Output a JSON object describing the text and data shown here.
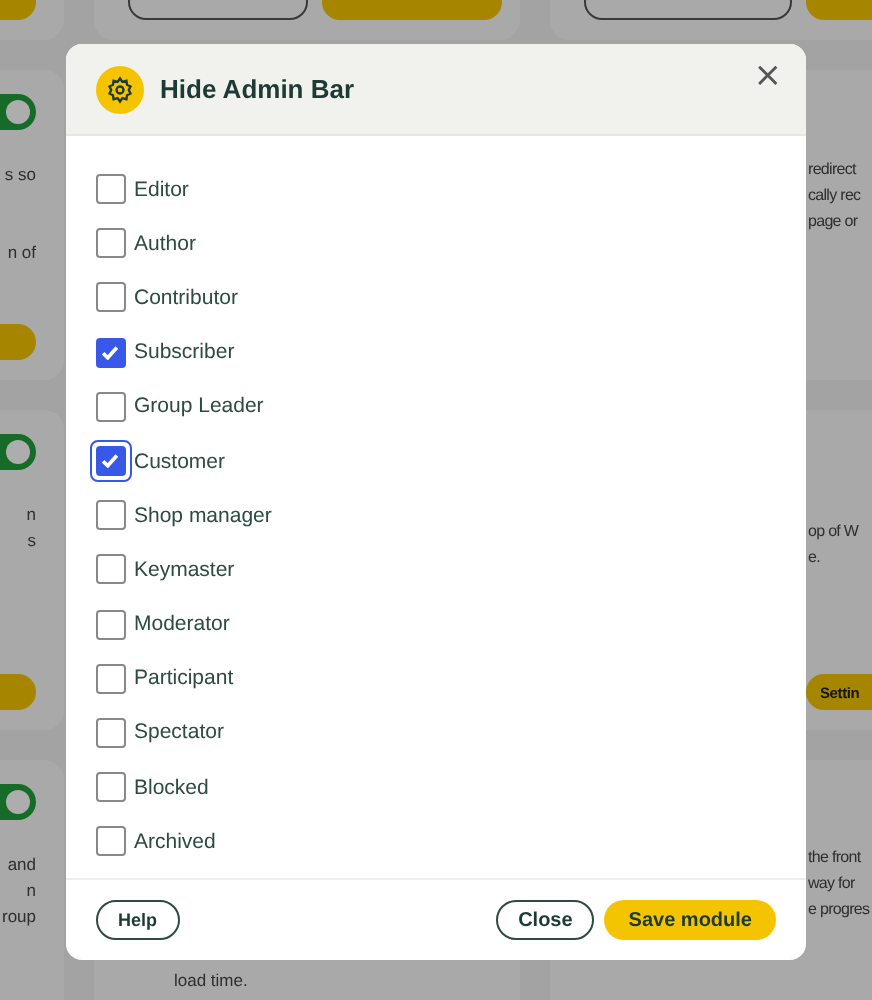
{
  "background": {
    "columns": [
      {
        "cards": [
          {
            "buttons": [
              {
                "kind": "primary"
              }
            ]
          },
          {
            "toggle_on": true,
            "paragraphs": [
              [
                "s so"
              ],
              [
                "n of"
              ]
            ],
            "buttons": [
              {
                "kind": "primary"
              }
            ]
          },
          {
            "toggle_on": true,
            "paragraphs": [
              [
                "n",
                "s"
              ]
            ],
            "buttons": [
              {
                "kind": "primary"
              }
            ]
          },
          {
            "toggle_on": true,
            "paragraphs": [
              [
                "and",
                "n",
                "roup"
              ]
            ]
          }
        ]
      },
      {
        "cards": [
          {
            "buttons": [
              {
                "kind": "secondary"
              },
              {
                "kind": "primary"
              }
            ]
          },
          {
            "paragraphs": [
              [
                "load time."
              ]
            ]
          }
        ]
      },
      {
        "cards": [
          {
            "buttons": [
              {
                "kind": "secondary"
              },
              {
                "kind": "primary"
              }
            ]
          },
          {
            "paragraphs": [
              [
                "redirect",
                "cally rec",
                "page or"
              ]
            ]
          },
          {
            "paragraphs": [
              [
                "op of W",
                "e."
              ]
            ],
            "buttons": [
              {
                "kind": "primary",
                "label": "Settin"
              }
            ]
          },
          {
            "paragraphs": [
              [
                "the front",
                "way for",
                "e progres"
              ]
            ]
          }
        ]
      }
    ]
  },
  "modal": {
    "title": "Hide Admin Bar",
    "close": "×",
    "roles": [
      {
        "label": "Editor",
        "checked": false,
        "focused": false
      },
      {
        "label": "Author",
        "checked": false,
        "focused": false
      },
      {
        "label": "Contributor",
        "checked": false,
        "focused": false
      },
      {
        "label": "Subscriber",
        "checked": true,
        "focused": false
      },
      {
        "label": "Group Leader",
        "checked": false,
        "focused": false
      },
      {
        "label": "Customer",
        "checked": true,
        "focused": true
      },
      {
        "label": "Shop manager",
        "checked": false,
        "focused": false
      },
      {
        "label": "Keymaster",
        "checked": false,
        "focused": false
      },
      {
        "label": "Moderator",
        "checked": false,
        "focused": false
      },
      {
        "label": "Participant",
        "checked": false,
        "focused": false
      },
      {
        "label": "Spectator",
        "checked": false,
        "focused": false
      },
      {
        "label": "Blocked",
        "checked": false,
        "focused": false
      },
      {
        "label": "Archived",
        "checked": false,
        "focused": false
      }
    ],
    "buttons": [
      {
        "label": "Help",
        "kind": "help"
      },
      {
        "label": "Close",
        "kind": "secondary"
      },
      {
        "label": "Save module",
        "kind": "primary"
      }
    ]
  }
}
